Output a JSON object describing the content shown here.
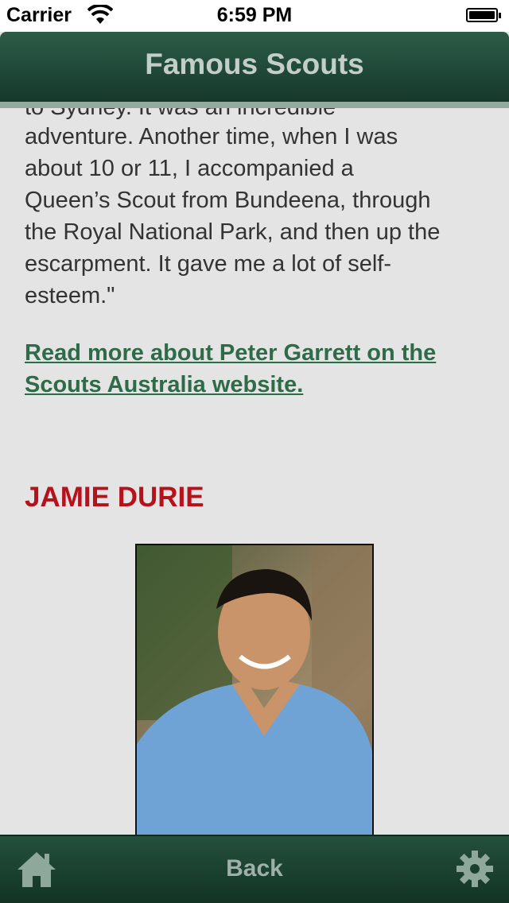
{
  "status": {
    "carrier": "Carrier",
    "time": "6:59 PM"
  },
  "nav": {
    "title": "Famous Scouts"
  },
  "article": {
    "cut_text": "to Sydney. It was an incredible",
    "paragraph_lines": [
      "adventure. Another time, when I was",
      "about 10 or 11, I accompanied a",
      "Queen’s Scout from Bundeena, through",
      "the Royal National Park, and then up the",
      "escarpment. It gave me a lot of self-",
      "esteem.\""
    ],
    "link_lines": [
      "Read more about Peter Garrett on the",
      "Scouts Australia website."
    ],
    "heading": "JAMIE DURIE"
  },
  "tabbar": {
    "back_label": "Back",
    "home_icon": "home-icon",
    "settings_icon": "gear-icon"
  }
}
